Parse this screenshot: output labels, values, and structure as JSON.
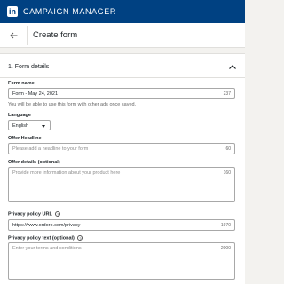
{
  "app": {
    "brand": "CAMPAIGN MANAGER",
    "logo_text": "in"
  },
  "header": {
    "title": "Create form"
  },
  "section": {
    "title": "1.   Form details"
  },
  "form_name": {
    "label": "Form name",
    "value": "Form - May 24, 2021",
    "counter": "237",
    "hint": "You will be able to use this form with other ads once saved."
  },
  "language": {
    "label": "Language",
    "value": "English"
  },
  "offer_headline": {
    "label": "Offer Headline",
    "placeholder": "Please add a headline to your form",
    "counter": "60"
  },
  "offer_details": {
    "label": "Offer details (optional)",
    "placeholder": "Provide more information about your product here",
    "counter": "160"
  },
  "privacy_url": {
    "label": "Privacy policy URL",
    "value": "https://www.ordoro.com/privacy",
    "counter": "1970"
  },
  "privacy_text": {
    "label": "Privacy policy text (optional)",
    "placeholder": "Enter your terms and conditions",
    "counter": "2000"
  },
  "colors": {
    "topbar": "#004182",
    "background": "#f3f2ef"
  }
}
